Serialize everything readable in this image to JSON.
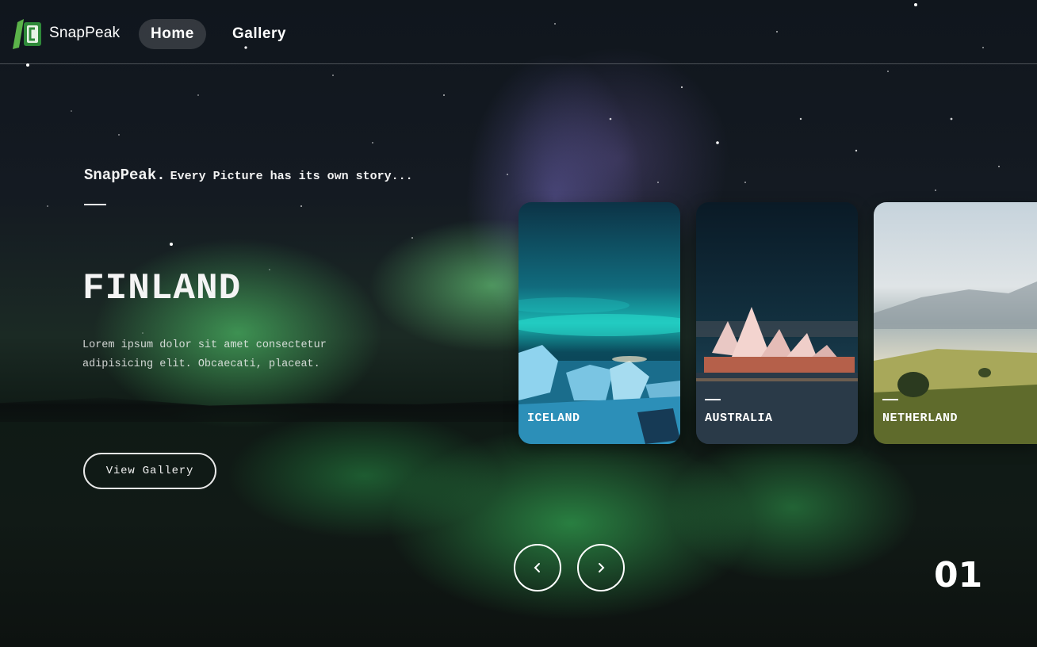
{
  "brand": {
    "name": "SnapPeak"
  },
  "nav": {
    "items": [
      {
        "label": "Home",
        "active": true
      },
      {
        "label": "Gallery",
        "active": false
      }
    ]
  },
  "hero": {
    "brand": "SnapPeak.",
    "tagline": "Every Picture has its own story...",
    "title": "FINLAND",
    "description": "Lorem ipsum dolor sit amet consectetur adipisicing elit. Obcaecati, placeat.",
    "button_label": "View Gallery"
  },
  "cards": [
    {
      "label": "ICELAND"
    },
    {
      "label": "AUSTRALIA"
    },
    {
      "label": "NETHERLAND"
    }
  ],
  "controls": {
    "prev_icon": "chevron-left-icon",
    "next_icon": "chevron-right-icon"
  },
  "slide_counter": "01",
  "colors": {
    "accent": "#ffffff",
    "aurora_green": "#3fd26a",
    "background": "#10161d"
  }
}
